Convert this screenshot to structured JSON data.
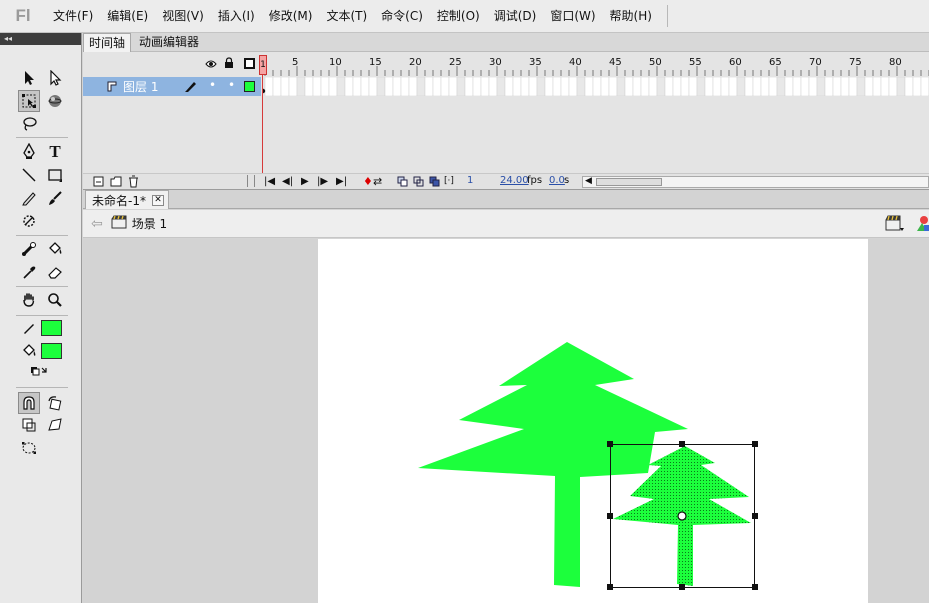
{
  "app": {
    "logo": "Fl"
  },
  "menu": {
    "items": [
      "文件(F)",
      "编辑(E)",
      "视图(V)",
      "插入(I)",
      "修改(M)",
      "文本(T)",
      "命令(C)",
      "控制(O)",
      "调试(D)",
      "窗口(W)",
      "帮助(H)"
    ]
  },
  "timeline": {
    "tabs": [
      "时间轴",
      "动画编辑器"
    ],
    "current_frame": "1",
    "frame_ruler": [
      "5",
      "10",
      "15",
      "20",
      "25",
      "30",
      "35",
      "40",
      "45",
      "50",
      "55",
      "60",
      "65",
      "70",
      "75",
      "80"
    ],
    "layer": {
      "name": "图层 1",
      "visible_dot": "•",
      "lock_dot": "•"
    },
    "status": {
      "frame": "1",
      "fps": "24.00",
      "fps_unit": "fps",
      "time": "0.0",
      "time_unit": "s"
    }
  },
  "document": {
    "tab_title": "未命名-1*",
    "close_glyph": "✕"
  },
  "scene": {
    "name": "场景 1"
  },
  "colors": {
    "shape_fill": "#1cff3c",
    "stroke_swatch": "#1cff3c",
    "fill_swatch": "#1cff3c",
    "layer_highlight": "#8eb4e0",
    "playhead": "#d63a3a"
  },
  "stage": {
    "shapes": [
      {
        "name": "large-tree",
        "selected": false
      },
      {
        "name": "small-tree",
        "selected": true
      }
    ]
  }
}
